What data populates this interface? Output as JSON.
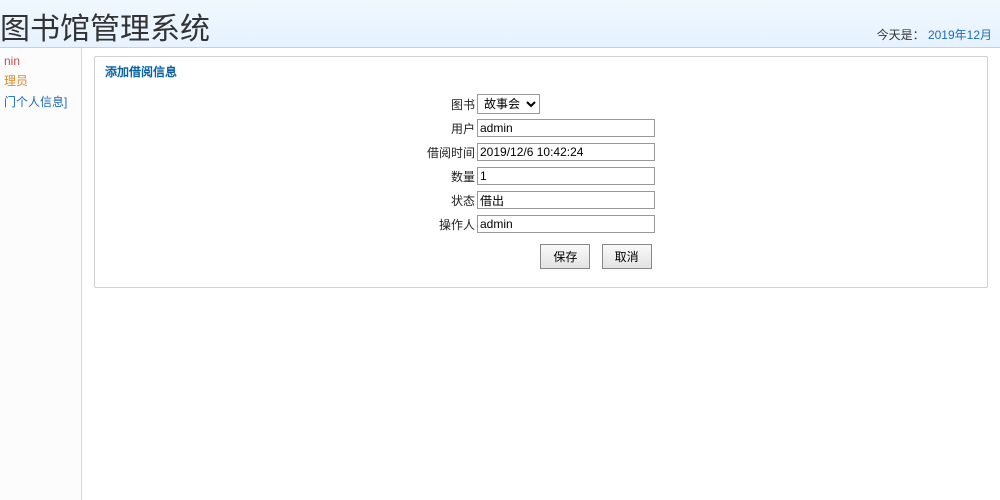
{
  "header": {
    "title": "图书馆管理系统",
    "date_label": "今天是：",
    "date_value": "2019年12月"
  },
  "sidebar": {
    "user": "nin",
    "role": "理员",
    "link": "门个人信息]"
  },
  "panel": {
    "title": "添加借阅信息"
  },
  "form": {
    "book_label": "图书",
    "book_value": "故事会",
    "user_label": "用户",
    "user_value": "admin",
    "time_label": "借阅时间",
    "time_value": "2019/12/6 10:42:24",
    "qty_label": "数量",
    "qty_value": "1",
    "status_label": "状态",
    "status_value": "借出",
    "operator_label": "操作人",
    "operator_value": "admin"
  },
  "buttons": {
    "save": "保存",
    "cancel": "取消"
  }
}
